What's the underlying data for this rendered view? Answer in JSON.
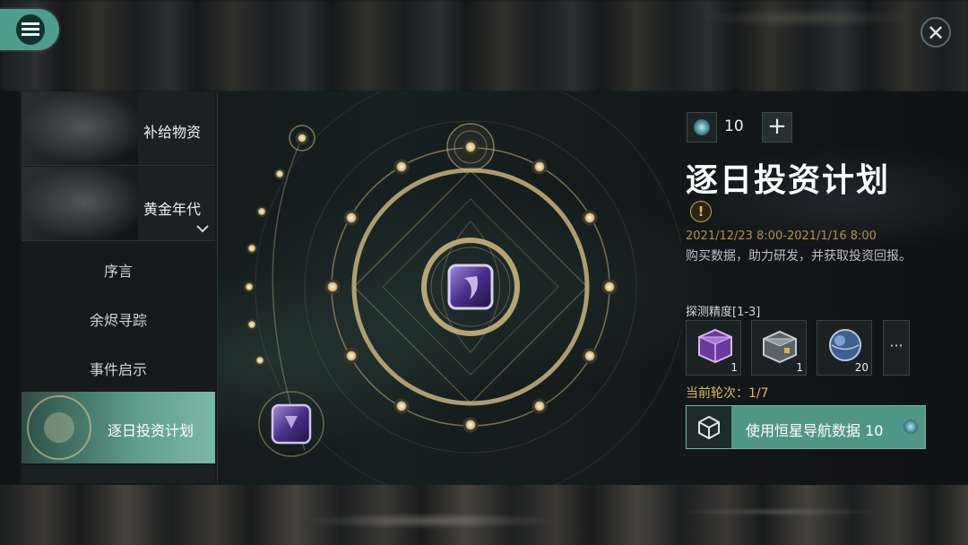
{
  "sidebar": {
    "items": [
      {
        "label": "补给物资"
      },
      {
        "label": "黄金年代"
      },
      {
        "label": "序言"
      },
      {
        "label": "余烬寻踪"
      },
      {
        "label": "事件启示"
      },
      {
        "label": "逐日投资计划"
      }
    ],
    "expand_icon": "chevron-down-icon"
  },
  "header": {
    "menu_icon": "hamburger-icon",
    "close_icon": "close-icon",
    "close_glyph": "✕"
  },
  "resource": {
    "icon": "star-nav-data-icon",
    "value": "10",
    "plus_glyph": "+"
  },
  "event": {
    "title": "逐日投资计划",
    "warn_glyph": "!",
    "date": "2021/12/23 8:00-2021/1/16 8:00",
    "description": "购买数据，助力研发，并获取投资回报。",
    "precision_label": "探测精度[1-3]",
    "rewards": [
      {
        "name": "purple-crate-icon",
        "count": "1"
      },
      {
        "name": "metal-crate-icon",
        "count": "1"
      },
      {
        "name": "blue-orb-icon",
        "count": "20"
      }
    ],
    "more_glyph": "···",
    "round_label": "当前轮次：1/7",
    "action_label": "使用恒星导航数据 10"
  },
  "colors": {
    "accent": "#509684",
    "gold": "#c9b37a",
    "date": "#b18f4c",
    "round": "#e0b860"
  }
}
